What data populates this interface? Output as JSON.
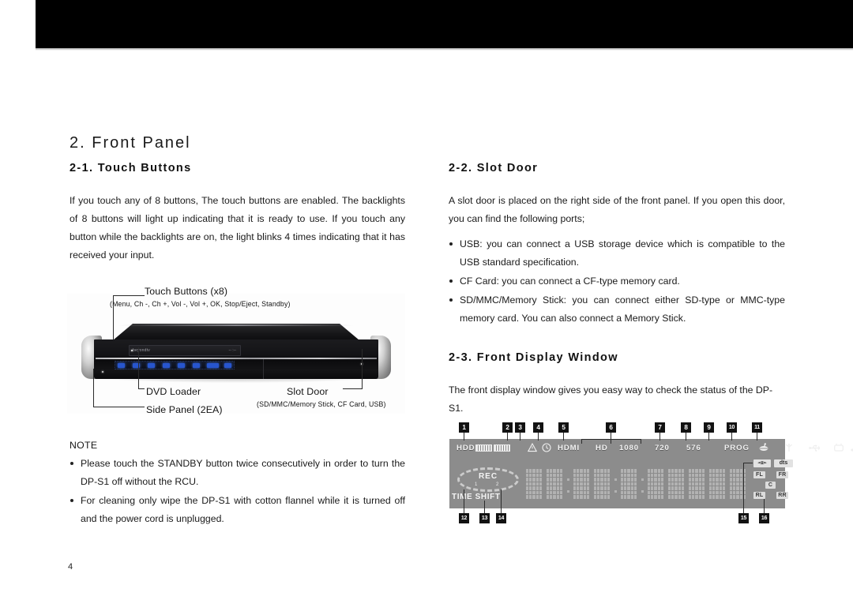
{
  "page": {
    "number": "4",
    "chapter_title": "2. Front Panel"
  },
  "sections": {
    "touch_buttons": {
      "heading": "2-1. Touch Buttons",
      "paragraph": "If you touch any of 8 buttons, The touch buttons are enabled. The backlights of 8 buttons will light up indicating that it is ready to use. If you touch any button while the backlights are on, the light blinks 4 times indicating that it has received your input."
    },
    "slot_door": {
      "heading": "2-2. Slot Door",
      "paragraph": "A slot door is placed on the right side of the front panel. If you open this door, you can find the following ports;",
      "bullets": [
        "USB: you can connect a USB storage device which is compatible to the USB standard specification.",
        "CF Card: you can connect a CF-type memory card.",
        "SD/MMC/Memory Stick: you can connect either SD-type or MMC-type memory card. You can also connect a Memory Stick."
      ]
    },
    "front_display_window": {
      "heading": "2-3. Front Display Window",
      "paragraph": "The front display window gives you easy way to check the status of the DP-S1."
    }
  },
  "figure": {
    "callouts": {
      "touch_buttons_title": "Touch Buttons (x8)",
      "touch_buttons_list": "(Menu, Ch -, Ch +, Vol -, Vol +, OK, Stop/Eject, Standby)",
      "dvd_loader": "DVD Loader",
      "side_panel": "Side Panel (2EA)",
      "slot_door": "Slot Door",
      "slot_door_sub": "(SD/MMC/Memory Stick, CF Card, USB)"
    },
    "device": {
      "vfd_logo": "beyondtv",
      "vfd_right": "-- :--"
    }
  },
  "note": {
    "title": "NOTE",
    "bullets": [
      "Please touch the STANDBY button twice consecutively in order to turn the DP-S1 off without the RCU.",
      "For cleaning only wipe the DP-S1 with cotton flannel while it is turned off and the power cord is unplugged."
    ]
  },
  "display_window": {
    "labels": {
      "hdd": "HDD",
      "hdmi": "HDMI",
      "hd": "HD",
      "res_1080": "1080",
      "res_720": "720",
      "res_576": "576",
      "prog": "PROG",
      "rec": "REC",
      "rec_1": "1",
      "rec_2": "2",
      "time_shift": "TIME SHIFT",
      "dts": "dts"
    },
    "speakers": [
      "FL",
      "FR",
      "C",
      "RL",
      "RR"
    ],
    "callout_numbers_top": [
      "1",
      "2",
      "3",
      "4",
      "5",
      "6",
      "7",
      "8",
      "9",
      "10",
      "11"
    ],
    "callout_numbers_bottom": [
      "12",
      "13",
      "14",
      "15",
      "16"
    ],
    "colors": {
      "panel_bg": "#8c8c8c",
      "label_text": "#f2f2f2",
      "matrix_dot": "#b2b2b2",
      "callout_box": "#121212"
    }
  }
}
